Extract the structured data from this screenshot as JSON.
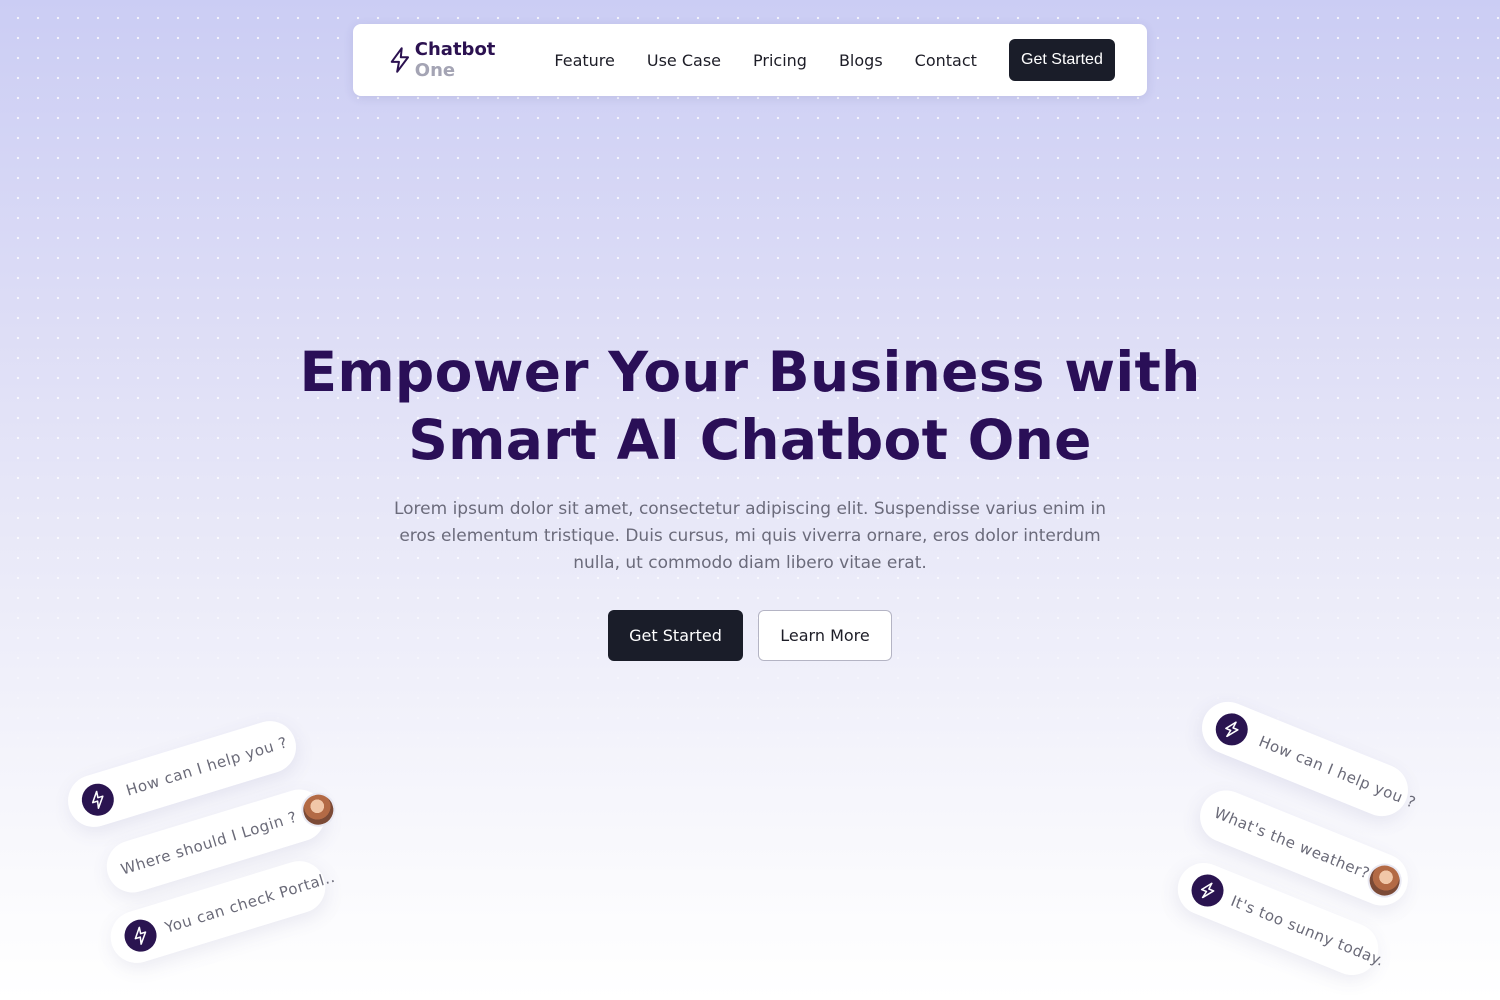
{
  "brand": {
    "name": "Chatbot",
    "suffix": "One",
    "color": "#2b1150"
  },
  "nav": {
    "links": [
      "Feature",
      "Use Case",
      "Pricing",
      "Blogs",
      "Contact"
    ],
    "cta": "Get Started"
  },
  "hero": {
    "title_line1": "Empower Your Business with",
    "title_line2": "Smart AI Chatbot One",
    "subtitle": "Lorem ipsum dolor sit amet, consectetur adipiscing elit. Suspendisse varius enim in eros elementum tristique. Duis cursus, mi quis viverra ornare, eros dolor interdum nulla, ut commodo diam libero vitae erat.",
    "primary_button": "Get Started",
    "secondary_button": "Learn More"
  },
  "chat_left": [
    {
      "from": "bot",
      "text": "How can I help you ?"
    },
    {
      "from": "user",
      "text": "Where should I Login ?"
    },
    {
      "from": "bot",
      "text": "You can check Portal.."
    }
  ],
  "chat_right": [
    {
      "from": "bot",
      "text": "How can I help you ?"
    },
    {
      "from": "user",
      "text": "What's the weather?"
    },
    {
      "from": "bot",
      "text": "It's too sunny today."
    }
  ],
  "icons": {
    "logo": "lightning-bolt-icon",
    "bot_avatar": "lightning-bolt-icon"
  },
  "colors": {
    "heading": "#2a0f57",
    "button_dark": "#1a1d29",
    "bot_avatar_bg": "#2a1450"
  }
}
